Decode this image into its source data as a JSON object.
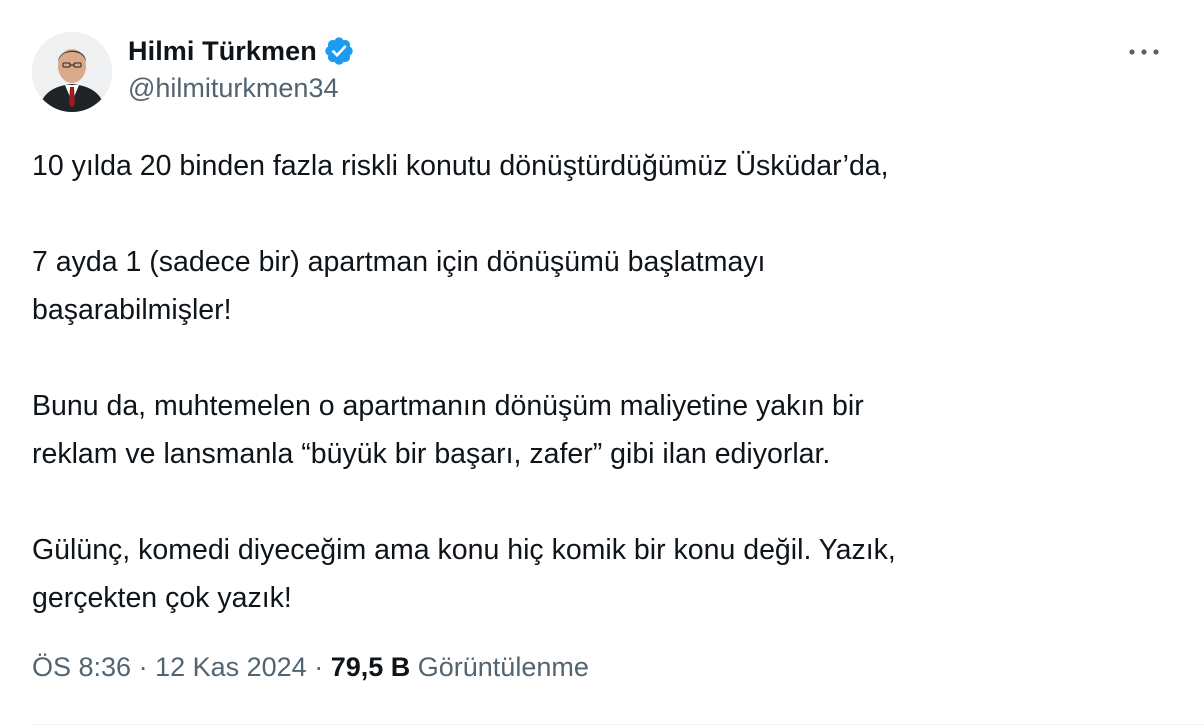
{
  "author": {
    "display_name": "Hilmi Türkmen",
    "handle": "@hilmiturkmen34",
    "verified": true
  },
  "icons": {
    "verified": "verified-badge-icon",
    "more": "more-options-icon"
  },
  "colors": {
    "verified_blue": "#1d9bf0",
    "text_primary": "#0f1419",
    "text_secondary": "#536471"
  },
  "tweet": {
    "paragraphs": [
      {
        "lines": [
          "10 yılda 20 binden fazla riskli konutu dönüştürdüğümüz Üsküdar’da,"
        ]
      },
      {
        "lines": [
          "7 ayda 1 (sadece bir) apartman için dönüşümü başlatmayı",
          "başarabilmişler!"
        ]
      },
      {
        "lines": [
          "Bunu da, muhtemelen o apartmanın dönüşüm maliyetine yakın bir",
          "reklam ve lansmanla “büyük bir başarı, zafer” gibi ilan ediyorlar."
        ]
      },
      {
        "lines": [
          "Gülünç, komedi diyeceğim ama konu hiç komik bir konu değil. Yazık,",
          "gerçekten çok yazık!"
        ]
      }
    ]
  },
  "meta": {
    "time": "ÖS 8:36",
    "separator": " · ",
    "date": "12 Kas 2024",
    "views_count": "79,5 B",
    "views_label": "Görüntülenme"
  }
}
